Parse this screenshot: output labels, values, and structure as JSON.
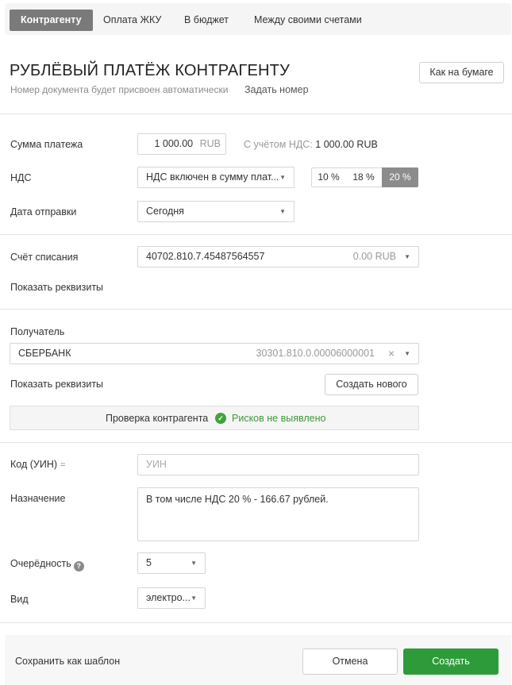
{
  "tabs": [
    "Контрагенту",
    "Оплата ЖКУ",
    "В бюджет",
    "Между своими счетами"
  ],
  "header": {
    "title": "РУБЛЁВЫЙ ПЛАТЁЖ КОНТРАГЕНТУ",
    "subtitle": "Номер документа будет присвоен автоматически",
    "set_number": "Задать номер",
    "paper_button": "Как на бумаге"
  },
  "payment": {
    "amount_label": "Сумма платежа",
    "amount_value": "1 000.00",
    "amount_currency": "RUB",
    "with_vat_label": "С учётом НДС:",
    "with_vat_value": "1 000.00 RUB",
    "vat_label": "НДС",
    "vat_select": "НДС включен в сумму плат...",
    "vat_rates": [
      "10 %",
      "18 %",
      "20 %"
    ],
    "vat_rate_selected": "20 %",
    "date_label": "Дата отправки",
    "date_value": "Сегодня"
  },
  "account": {
    "label": "Счёт списания",
    "number": "40702.810.7.45487564557",
    "balance": "0.00 RUB",
    "show_details": "Показать реквизиты"
  },
  "recipient": {
    "label": "Получатель",
    "name": "СБЕРБАНК",
    "account": "30301.810.0.00006000001",
    "show_details": "Показать реквизиты",
    "create_new": "Создать нового",
    "check_label": "Проверка контрагента",
    "check_result": "Рисков не выявлено"
  },
  "details": {
    "uin_label": "Код (УИН)",
    "uin_placeholder": "УИН",
    "purpose_label": "Назначение",
    "purpose_value": "В том числе НДС 20 % - 166.67 рублей.",
    "priority_label": "Очерёдность",
    "priority_value": "5",
    "kind_label": "Вид",
    "kind_value": "электро..."
  },
  "footer": {
    "save_template": "Сохранить как шаблон",
    "cancel": "Отмена",
    "create": "Создать"
  },
  "colors": {
    "primary_green": "#2e9b3a",
    "link_blue": "#3a6a9a",
    "active_tab": "#7a7a7a"
  }
}
